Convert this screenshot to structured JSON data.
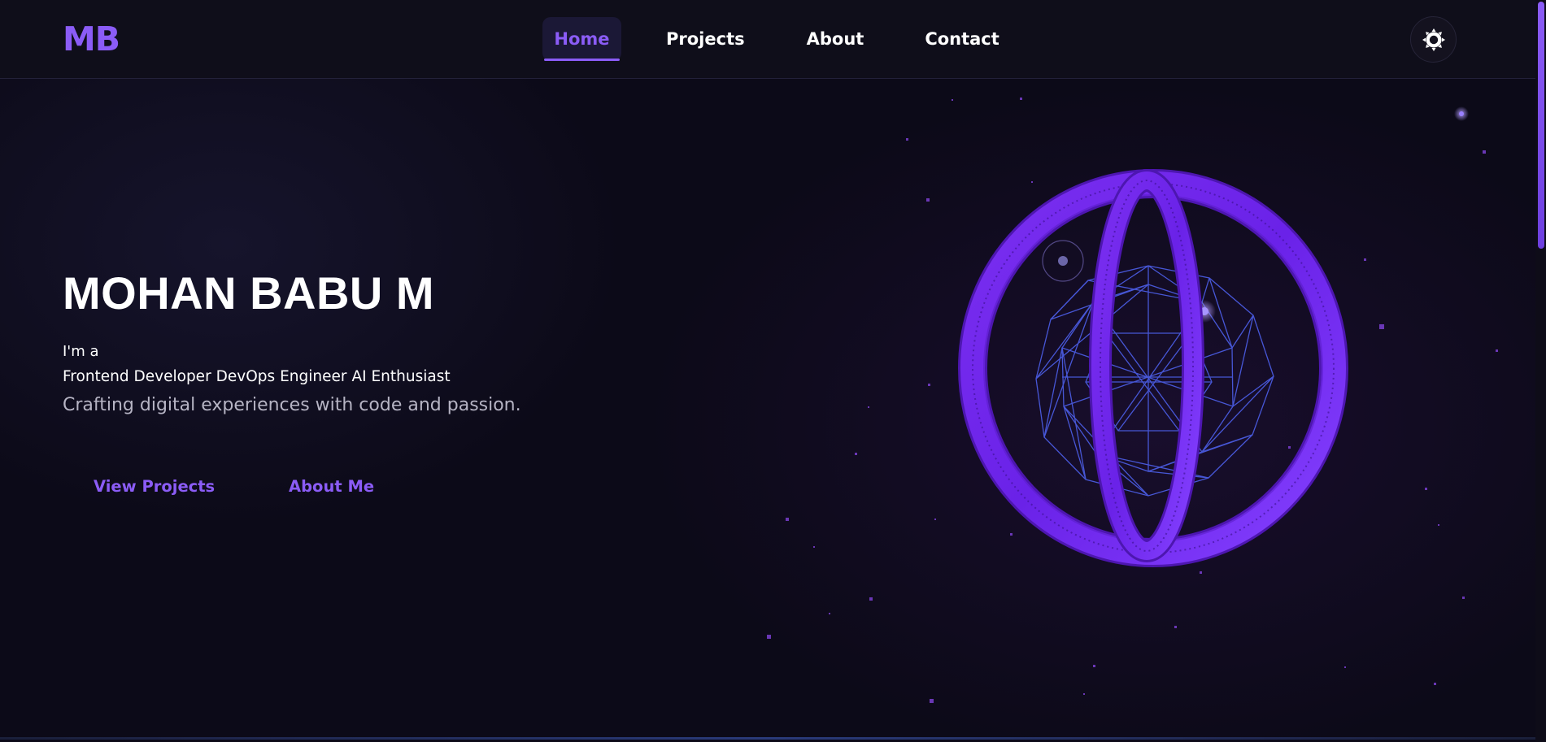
{
  "header": {
    "logo": "MB",
    "nav": [
      {
        "label": "Home",
        "active": true
      },
      {
        "label": "Projects",
        "active": false
      },
      {
        "label": "About",
        "active": false
      },
      {
        "label": "Contact",
        "active": false
      }
    ],
    "theme_toggle_icon": "sun-gear-icon"
  },
  "hero": {
    "name": "MOHAN BABU M",
    "intro": "I'm a",
    "roles": [
      "Frontend Developer",
      "DevOps Engineer",
      "AI Enthusiast"
    ],
    "tagline": "Crafting digital experiences with code and passion.",
    "buttons": {
      "view_projects": "View Projects",
      "about_me": "About Me"
    },
    "visual": "3d-torus-sphere-icon"
  },
  "colors": {
    "accent": "#8b5cf6",
    "background": "#0c0a18",
    "header_bg": "#0f0e1a",
    "wireframe": "#4a5be0",
    "torus": "#7c2cf0"
  }
}
